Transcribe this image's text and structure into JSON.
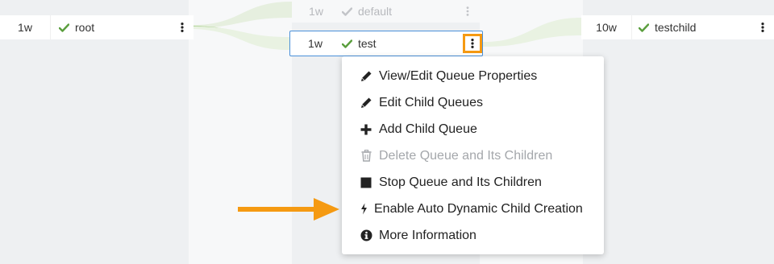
{
  "colors": {
    "check_green": "#5a9e3d",
    "check_muted": "#c2c4c8",
    "selected_border": "#4a90d9",
    "highlight_orange": "#f59a12",
    "link_green": "#a8d08d"
  },
  "queues": {
    "root": {
      "weight": "1w",
      "name": "root",
      "status_icon": "check-icon",
      "menu_icon": "vertical-dots-icon"
    },
    "default": {
      "weight": "1w",
      "name": "default",
      "status_icon": "check-icon",
      "menu_icon": "vertical-dots-icon"
    },
    "test": {
      "weight": "1w",
      "name": "test",
      "status_icon": "check-icon",
      "menu_icon": "vertical-dots-icon"
    },
    "testchild": {
      "weight": "10w",
      "name": "testchild",
      "status_icon": "check-icon",
      "menu_icon": "vertical-dots-icon"
    }
  },
  "context_menu": {
    "items": [
      {
        "label": "View/Edit Queue Properties",
        "icon": "pencil-icon",
        "enabled": true
      },
      {
        "label": "Edit Child Queues",
        "icon": "pencil-icon",
        "enabled": true
      },
      {
        "label": "Add Child Queue",
        "icon": "plus-icon",
        "enabled": true
      },
      {
        "label": "Delete Queue and Its Children",
        "icon": "trash-icon",
        "enabled": false
      },
      {
        "label": "Stop Queue and Its Children",
        "icon": "stop-square-icon",
        "enabled": true
      },
      {
        "label": "Enable Auto Dynamic Child Creation",
        "icon": "bolt-icon",
        "enabled": true
      },
      {
        "label": "More Information",
        "icon": "info-circle-icon",
        "enabled": true
      }
    ]
  },
  "annotation": {
    "icon": "arrow-right-icon"
  }
}
